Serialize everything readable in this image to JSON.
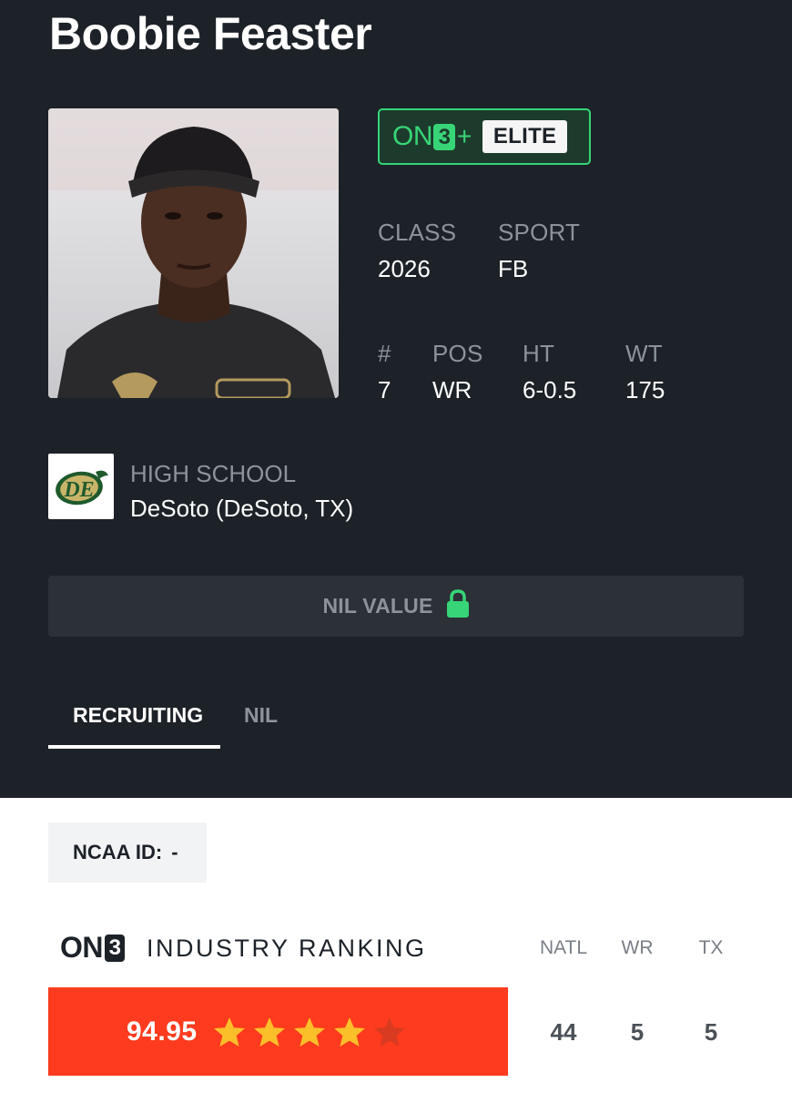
{
  "player": {
    "name": "Boobie Feaster"
  },
  "badge": {
    "brand_prefix": "ON",
    "brand_number": "3",
    "brand_plus": "+",
    "tier": "ELITE"
  },
  "bio": {
    "class_label": "CLASS",
    "class_value": "2026",
    "sport_label": "SPORT",
    "sport_value": "FB",
    "number_label": "#",
    "number_value": "7",
    "pos_label": "POS",
    "pos_value": "WR",
    "ht_label": "HT",
    "ht_value": "6-0.5",
    "wt_label": "WT",
    "wt_value": "175"
  },
  "school": {
    "label": "HIGH SCHOOL",
    "name": "DeSoto (DeSoto, TX)",
    "logo_text": "DE"
  },
  "nil": {
    "label": "NIL VALUE",
    "icon": "lock-icon"
  },
  "tabs": [
    {
      "label": "RECRUITING",
      "active": true
    },
    {
      "label": "NIL",
      "active": false
    }
  ],
  "ncaa": {
    "label": "NCAA ID:",
    "value": "-"
  },
  "ranking": {
    "brand_prefix": "ON",
    "brand_number": "3",
    "title": "INDUSTRY RANKING",
    "rating": "94.95",
    "stars_filled": 4,
    "stars_total": 5,
    "columns": [
      {
        "label": "NATL",
        "value": "44"
      },
      {
        "label": "WR",
        "value": "5"
      },
      {
        "label": "TX",
        "value": "5"
      }
    ]
  },
  "colors": {
    "background_dark": "#1c2228",
    "accent_green": "#37d577",
    "rating_red": "#fe3b1e",
    "star_gold": "#fbbf2a",
    "star_empty": "#d93a22"
  }
}
